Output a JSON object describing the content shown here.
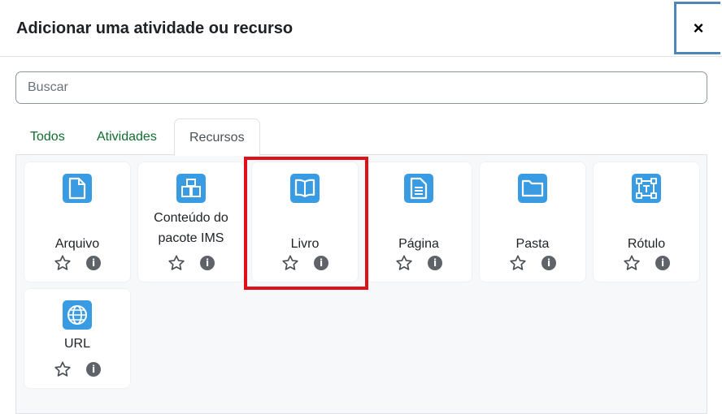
{
  "modal": {
    "title": "Adicionar uma atividade ou recurso",
    "close_label": "×"
  },
  "search": {
    "placeholder": "Buscar"
  },
  "tabs": [
    {
      "label": "Todos"
    },
    {
      "label": "Atividades"
    },
    {
      "label": "Recursos"
    }
  ],
  "items": [
    {
      "label": "Arquivo",
      "icon": "file-icon"
    },
    {
      "label": "Conteúdo do pacote IMS",
      "icon": "ims-package-icon"
    },
    {
      "label": "Livro",
      "icon": "book-icon"
    },
    {
      "label": "Página",
      "icon": "page-icon"
    },
    {
      "label": "Pasta",
      "icon": "folder-icon"
    },
    {
      "label": "Rótulo",
      "icon": "label-icon"
    },
    {
      "label": "URL",
      "icon": "globe-icon"
    }
  ],
  "info_glyph": "i",
  "colors": {
    "icon_bg": "#399be2",
    "tab_link": "#0f6e2e",
    "highlight": "#e0101a"
  }
}
